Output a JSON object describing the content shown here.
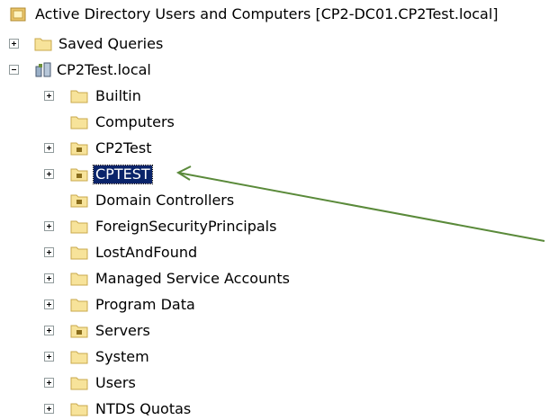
{
  "tree": {
    "root": {
      "label": "Active Directory Users and Computers [CP2-DC01.CP2Test.local]",
      "icon": "ad-console-icon"
    },
    "saved_queries": {
      "label": "Saved Queries",
      "icon": "folder-icon"
    },
    "domain": {
      "label": "CP2Test.local",
      "icon": "domain-icon"
    },
    "children": [
      {
        "label": "Builtin",
        "icon": "folder-icon",
        "expandable": true
      },
      {
        "label": "Computers",
        "icon": "folder-icon",
        "expandable": false
      },
      {
        "label": "CP2Test",
        "icon": "ou-icon",
        "expandable": true
      },
      {
        "label": "CPTEST",
        "icon": "ou-icon",
        "expandable": true,
        "selected": true
      },
      {
        "label": "Domain Controllers",
        "icon": "ou-icon",
        "expandable": false
      },
      {
        "label": "ForeignSecurityPrincipals",
        "icon": "folder-icon",
        "expandable": true
      },
      {
        "label": "LostAndFound",
        "icon": "folder-icon",
        "expandable": true
      },
      {
        "label": "Managed Service Accounts",
        "icon": "folder-icon",
        "expandable": true
      },
      {
        "label": "Program Data",
        "icon": "folder-icon",
        "expandable": true
      },
      {
        "label": "Servers",
        "icon": "ou-icon",
        "expandable": true
      },
      {
        "label": "System",
        "icon": "folder-icon",
        "expandable": true
      },
      {
        "label": "Users",
        "icon": "folder-icon",
        "expandable": true
      },
      {
        "label": "NTDS Quotas",
        "icon": "folder-icon",
        "expandable": true
      }
    ]
  },
  "colors": {
    "selection": "#0a246a",
    "folder": "#f7e39a",
    "arrow": "#5a8a3a"
  }
}
